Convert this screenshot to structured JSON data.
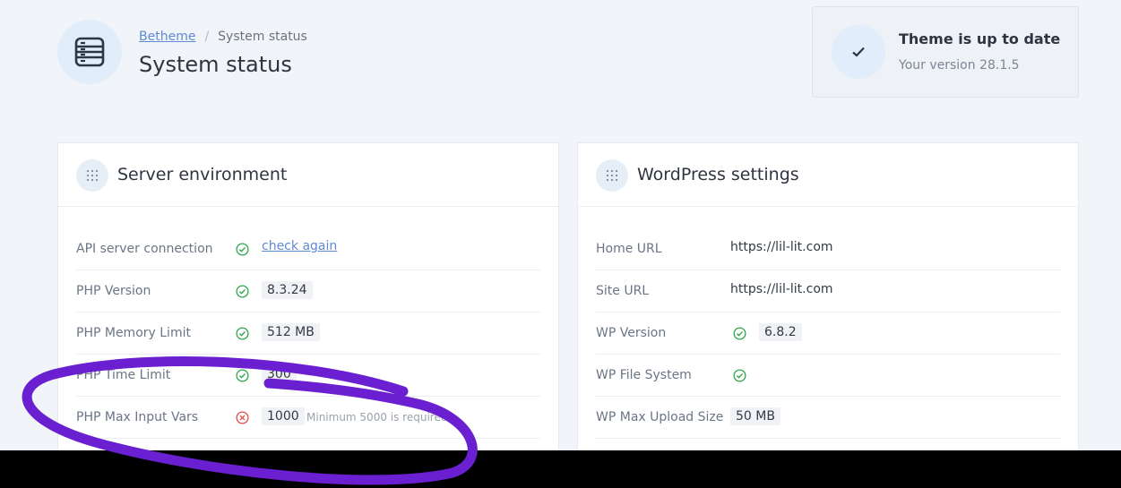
{
  "header": {
    "breadcrumb_root": "Betheme",
    "breadcrumb_separator": "/",
    "breadcrumb_current": "System status",
    "title": "System status",
    "page_icon": "server-icon"
  },
  "update_status": {
    "title": "Theme is up to date",
    "version": "Your version 28.1.5",
    "icon": "checkmark-icon"
  },
  "server_environment": {
    "title": "Server environment",
    "rows": [
      {
        "label": "API server connection",
        "status": "ok",
        "value": "check again",
        "type": "link"
      },
      {
        "label": "PHP Version",
        "status": "ok",
        "value": "8.3.24",
        "type": "badge"
      },
      {
        "label": "PHP Memory Limit",
        "status": "ok",
        "value": "512 MB",
        "type": "badge"
      },
      {
        "label": "PHP Time Limit",
        "status": "ok",
        "value": "300",
        "type": "badge"
      },
      {
        "label": "PHP Max Input Vars",
        "status": "error",
        "value": "1000",
        "type": "badge",
        "note": "Minimum 5000 is required"
      }
    ]
  },
  "wordpress_settings": {
    "title": "WordPress settings",
    "rows": [
      {
        "label": "Home URL",
        "value": "https://lil-lit.com",
        "type": "text"
      },
      {
        "label": "Site URL",
        "value": "https://lil-lit.com",
        "type": "text"
      },
      {
        "label": "WP Version",
        "status": "ok",
        "value": "6.8.2",
        "type": "badge"
      },
      {
        "label": "WP File System",
        "status": "ok",
        "value": "",
        "type": "none"
      },
      {
        "label": "WP Max Upload Size",
        "value": "50 MB",
        "type": "badge"
      }
    ]
  },
  "colors": {
    "accent": "#5f8ad4",
    "ok": "#2fa84f",
    "error": "#e34b4b",
    "annotation": "#6a1fd0"
  }
}
